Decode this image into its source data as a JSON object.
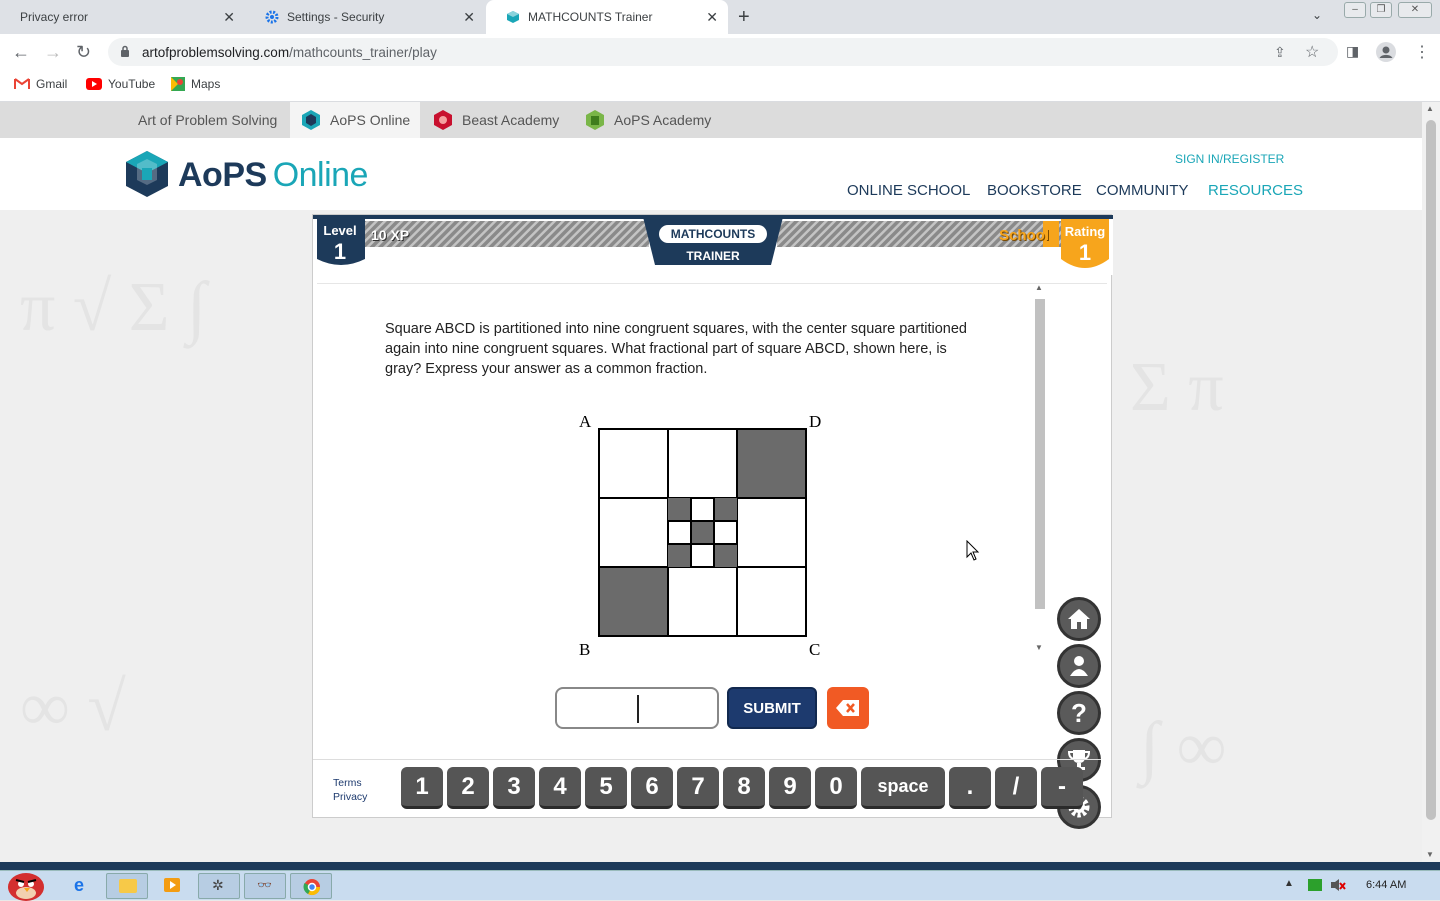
{
  "browser": {
    "tabs": [
      {
        "label": "Privacy error"
      },
      {
        "label": "Settings - Security"
      },
      {
        "label": "MATHCOUNTS Trainer"
      }
    ],
    "url_host": "artofproblemsolving.com",
    "url_path": "/mathcounts_trainer/play",
    "bookmarks": [
      {
        "label": "Gmail"
      },
      {
        "label": "YouTube"
      },
      {
        "label": "Maps"
      }
    ]
  },
  "site_nav": {
    "items": [
      {
        "label": "Art of Problem Solving"
      },
      {
        "label": "AoPS Online"
      },
      {
        "label": "Beast Academy"
      },
      {
        "label": "AoPS Academy"
      }
    ]
  },
  "header": {
    "logo_main": "AoPS",
    "logo_sub": "Online",
    "sign_in": "SIGN IN/REGISTER",
    "menu": [
      {
        "label": "ONLINE SCHOOL"
      },
      {
        "label": "BOOKSTORE"
      },
      {
        "label": "COMMUNITY"
      },
      {
        "label": "RESOURCES"
      }
    ]
  },
  "trainer": {
    "level_label": "Level",
    "level_value": "1",
    "xp": "10 XP",
    "logo_top": "MATHCOUNTS",
    "logo_bottom": "TRAINER",
    "school": "School",
    "rating_label": "Rating",
    "rating_value": "1",
    "question": "Square ABCD is partitioned into nine congruent squares, with the center square partitioned again into nine congruent squares. What fractional part of square ABCD, shown here, is gray? Express your answer as a common fraction.",
    "figure_labels": {
      "a": "A",
      "b": "B",
      "c": "C",
      "d": "D"
    },
    "answer_value": "",
    "submit_label": "SUBMIT",
    "terms": "Terms",
    "privacy": "Privacy",
    "keys": [
      "1",
      "2",
      "3",
      "4",
      "5",
      "6",
      "7",
      "8",
      "9",
      "0",
      "space",
      ".",
      "/",
      "-"
    ]
  },
  "taskbar": {
    "clock": "6:44 AM"
  },
  "colors": {
    "navy": "#1d3a5a",
    "teal": "#1aa6b7",
    "orange": "#f15a24",
    "gray_fill": "#6b6b6b"
  }
}
